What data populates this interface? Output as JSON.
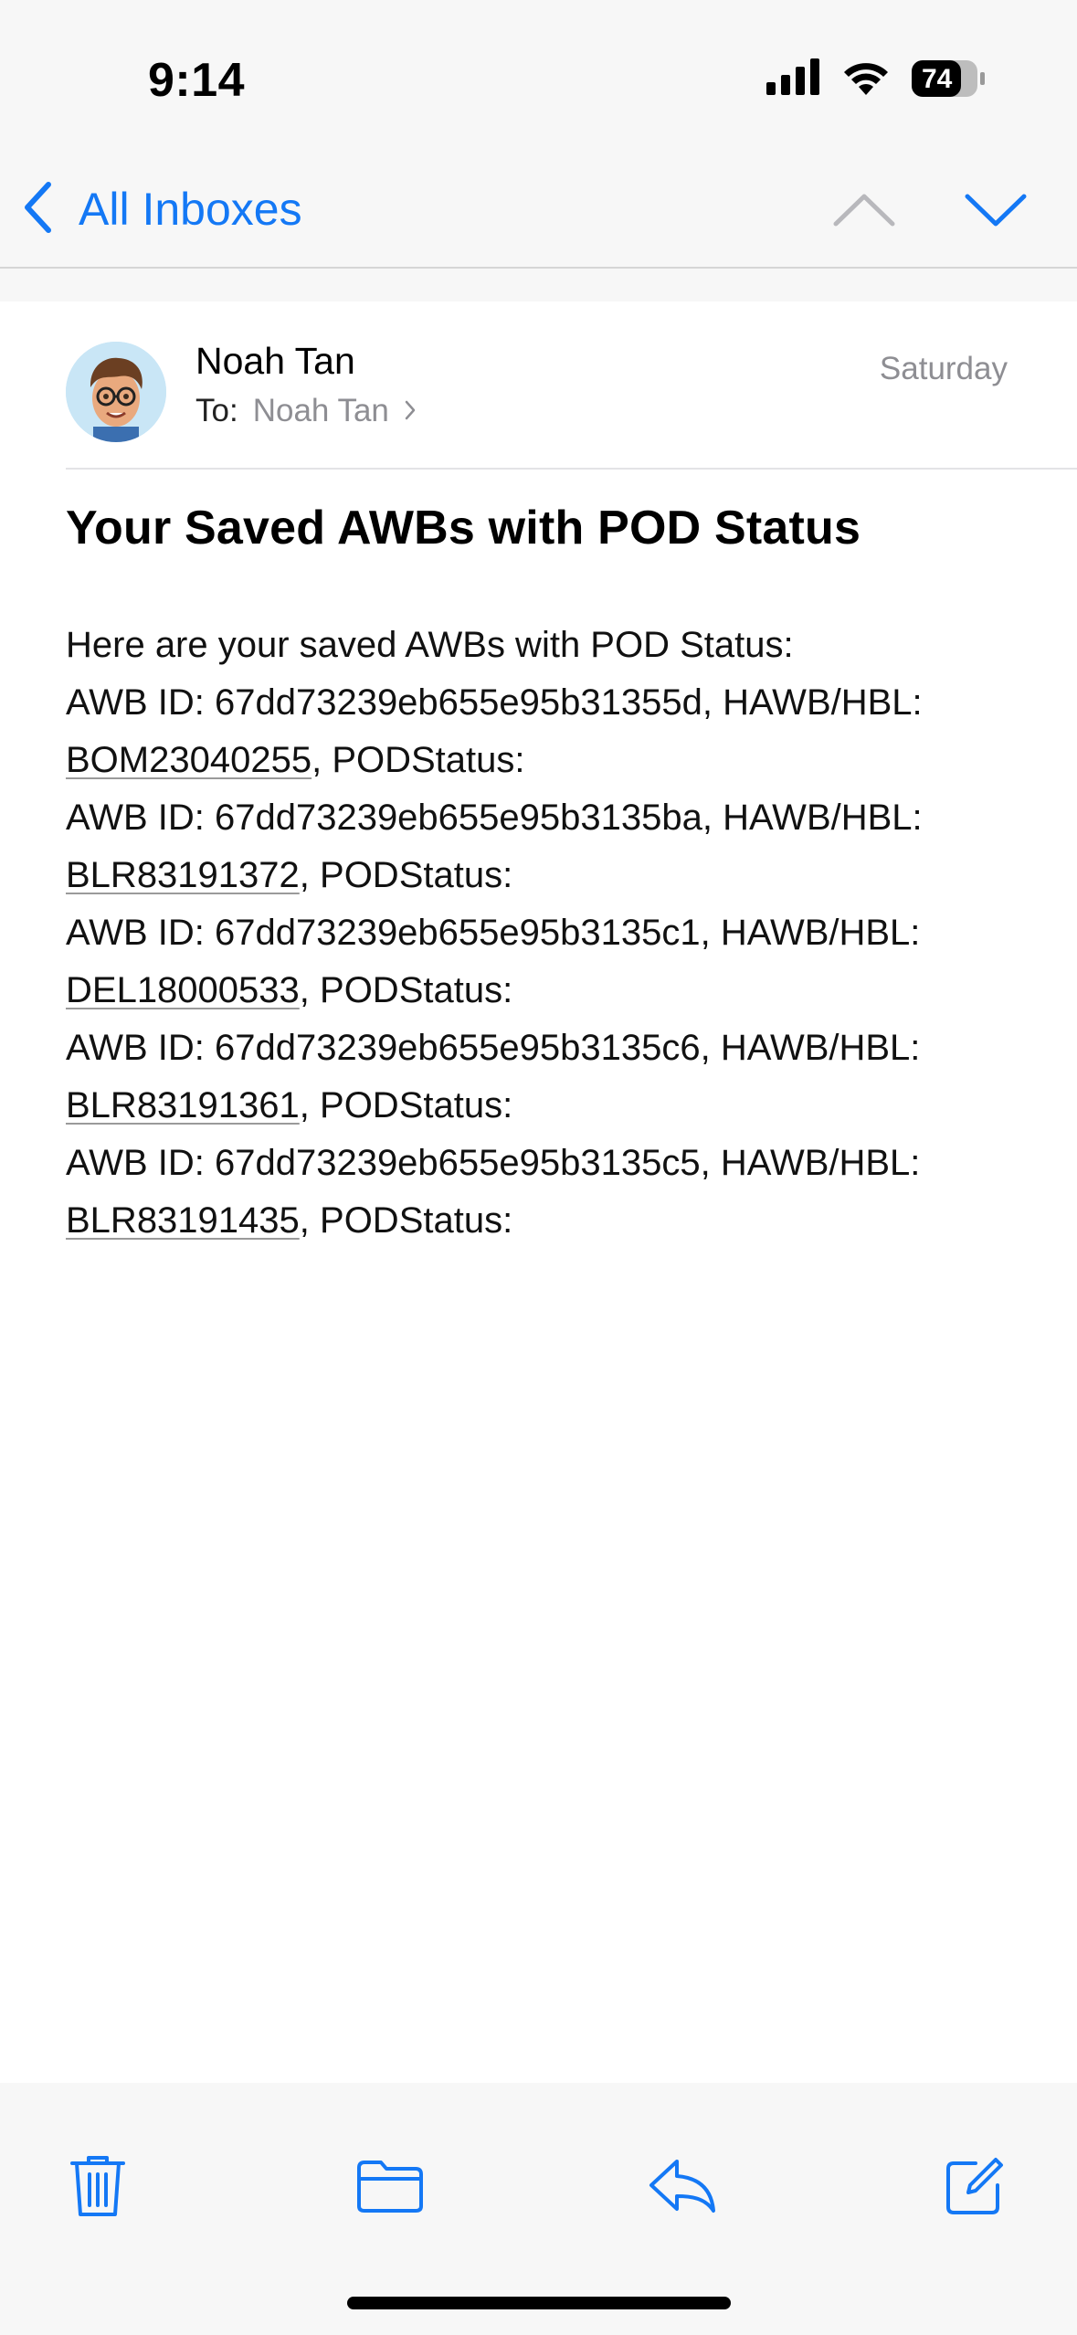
{
  "status_bar": {
    "time": "9:14",
    "battery": "74",
    "icons": [
      "cellular-signal-icon",
      "wifi-icon",
      "battery-icon"
    ]
  },
  "nav": {
    "back_label": "All Inboxes",
    "back_icon": "chevron-left-icon",
    "prev_icon": "chevron-up-icon",
    "next_icon": "chevron-down-icon"
  },
  "message": {
    "sender": "Noah Tan",
    "to_label": "To:",
    "to_name": "Noah Tan",
    "date": "Saturday",
    "subject": "Your Saved AWBs with POD Status",
    "intro": "Here are your saved AWBs with POD Status:",
    "entries": [
      {
        "awb": "AWB ID: 67dd73239eb655e95b31355d, HAWB/HBL:",
        "hbl": "BOM23040255",
        "status": ", PODStatus:"
      },
      {
        "awb": "AWB ID: 67dd73239eb655e95b3135ba, HAWB/HBL:",
        "hbl": "BLR83191372",
        "status": ", PODStatus:"
      },
      {
        "awb": "AWB ID: 67dd73239eb655e95b3135c1, HAWB/HBL:",
        "hbl": "DEL18000533",
        "status": ", PODStatus:"
      },
      {
        "awb": "AWB ID: 67dd73239eb655e95b3135c6, HAWB/HBL:",
        "hbl": "BLR83191361",
        "status": ", PODStatus:"
      },
      {
        "awb": "AWB ID: 67dd73239eb655e95b3135c5, HAWB/HBL:",
        "hbl": "BLR83191435",
        "status": ", PODStatus:"
      }
    ]
  },
  "toolbar": {
    "icons": [
      "trash-icon",
      "folder-icon",
      "reply-icon",
      "compose-icon"
    ]
  },
  "colors": {
    "accent": "#1478f5",
    "secondary_text": "#8e8e93",
    "background": "#f7f7f7",
    "content_background": "#ffffff"
  }
}
